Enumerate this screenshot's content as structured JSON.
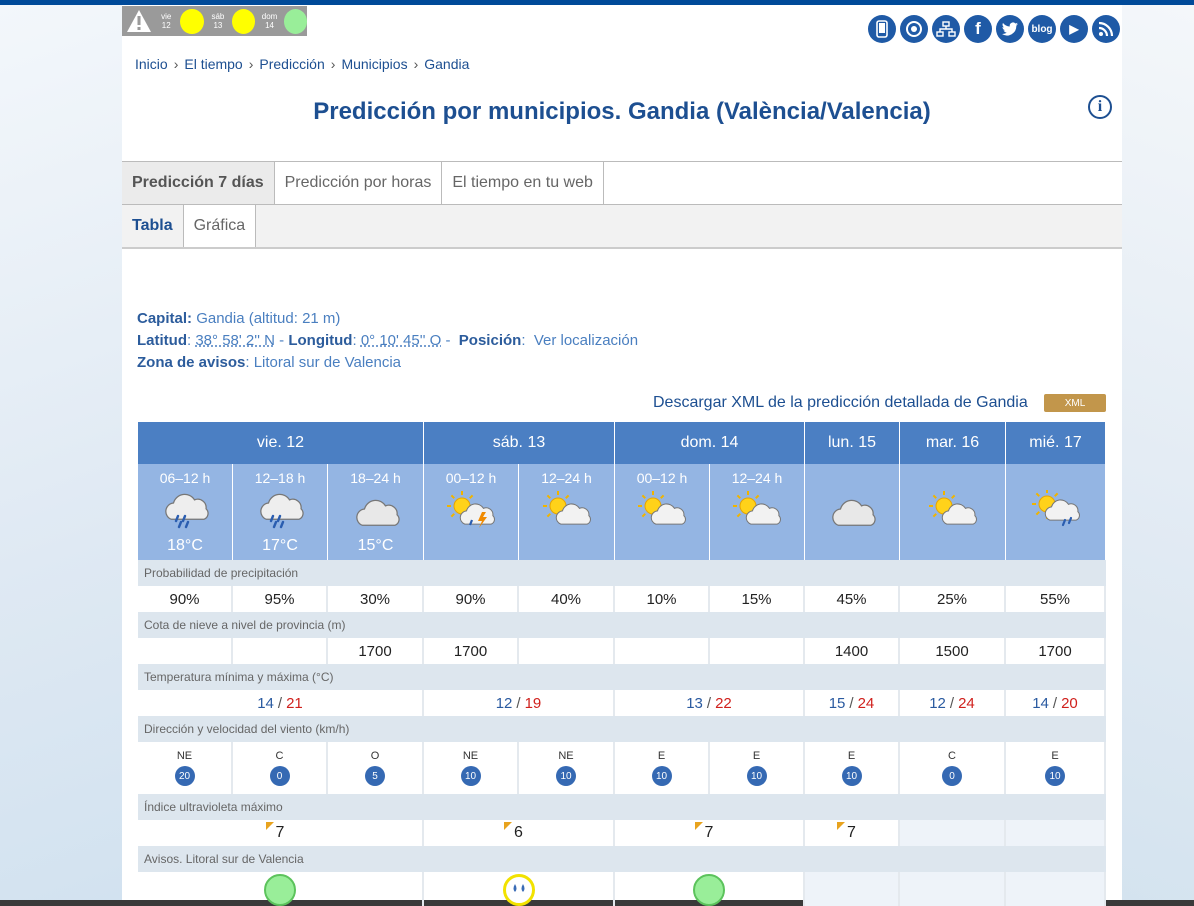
{
  "warnings_mini": {
    "days": [
      {
        "label": "vie\n12",
        "d": "vie",
        "n": "12",
        "color": "#ffff00"
      },
      {
        "label": "sáb\n13",
        "d": "sáb",
        "n": "13",
        "color": "#ffff00"
      },
      {
        "label": "dom\n14",
        "d": "dom",
        "n": "14",
        "color": "#99ee99"
      }
    ]
  },
  "social": [
    "mobile-icon",
    "hub-icon",
    "sitemap-icon",
    "facebook-icon",
    "twitter-icon",
    "blog-icon",
    "youtube-icon",
    "rss-icon"
  ],
  "social_labels": {
    "facebook": "f",
    "blog": "blog",
    "youtube": "▶",
    "rss": ")))"
  },
  "breadcrumb": [
    "Inicio",
    "El tiempo",
    "Predicción",
    "Municipios",
    "Gandia"
  ],
  "title": "Predicción por municipios. Gandia (València/Valencia)",
  "tabs_main": [
    "Predicción 7 días",
    "Predicción por horas",
    "El tiempo en tu web"
  ],
  "tabs_sub": [
    "Tabla",
    "Gráfica"
  ],
  "info": {
    "capital_label": "Capital:",
    "capital_value": "Gandia (altitud: 21 m)",
    "lat_label": "Latitud",
    "lat_value": "38° 58' 2'' N",
    "lon_label": "Longitud",
    "lon_value": "0° 10' 45'' O",
    "pos_label": "Posición",
    "pos_value": "Ver localización",
    "zone_label": "Zona de avisos",
    "zone_value": "Litoral sur de Valencia"
  },
  "xml": {
    "link": "Descargar XML de la predicción detallada de Gandia",
    "badge": "XML"
  },
  "days": [
    "vie. 12",
    "sáb. 13",
    "dom. 14",
    "lun. 15",
    "mar. 16",
    "mié. 17"
  ],
  "periods": [
    {
      "time": "06–12 h",
      "icon": "rain-cloud",
      "temp": "18°C"
    },
    {
      "time": "12–18 h",
      "icon": "rain-cloud",
      "temp": "17°C"
    },
    {
      "time": "18–24 h",
      "icon": "cloud",
      "temp": "15°C"
    },
    {
      "time": "00–12 h",
      "icon": "sun-storm",
      "temp": ""
    },
    {
      "time": "12–24 h",
      "icon": "sun-cloud",
      "temp": ""
    },
    {
      "time": "00–12 h",
      "icon": "sun-cloud",
      "temp": ""
    },
    {
      "time": "12–24 h",
      "icon": "sun-cloud",
      "temp": ""
    },
    {
      "time": "",
      "icon": "cloud",
      "temp": ""
    },
    {
      "time": "",
      "icon": "sun-cloud",
      "temp": ""
    },
    {
      "time": "",
      "icon": "sun-rain",
      "temp": ""
    }
  ],
  "labels": {
    "precip": "Probabilidad de precipitación",
    "snow": "Cota de nieve a nivel de provincia (m)",
    "temp": "Temperatura mínima y máxima (°C)",
    "wind": "Dirección y velocidad del viento (km/h)",
    "uv": "Índice ultravioleta máximo",
    "warn": "Avisos. Litoral sur de Valencia"
  },
  "precip": [
    "90%",
    "95%",
    "30%",
    "90%",
    "40%",
    "10%",
    "15%",
    "45%",
    "25%",
    "55%"
  ],
  "snow": [
    "",
    "",
    "1700",
    "1700",
    "",
    "",
    "",
    "1400",
    "1500",
    "1700"
  ],
  "temps": [
    {
      "min": "14",
      "max": "21"
    },
    {
      "min": "12",
      "max": "19"
    },
    {
      "min": "13",
      "max": "22"
    },
    {
      "min": "15",
      "max": "24"
    },
    {
      "min": "12",
      "max": "24"
    },
    {
      "min": "14",
      "max": "20"
    }
  ],
  "wind": [
    {
      "dir": "NE",
      "speed": "20"
    },
    {
      "dir": "C",
      "speed": "0"
    },
    {
      "dir": "O",
      "speed": "5"
    },
    {
      "dir": "NE",
      "speed": "10"
    },
    {
      "dir": "NE",
      "speed": "10"
    },
    {
      "dir": "E",
      "speed": "10"
    },
    {
      "dir": "E",
      "speed": "10"
    },
    {
      "dir": "E",
      "speed": "10"
    },
    {
      "dir": "C",
      "speed": "0"
    },
    {
      "dir": "E",
      "speed": "10"
    }
  ],
  "uv": [
    "7",
    "6",
    "7",
    "7",
    "",
    ""
  ],
  "warnings": [
    {
      "level": "green",
      "color": "#99ee99"
    },
    {
      "level": "yellow-rain",
      "color": "#ffff00"
    },
    {
      "level": "green",
      "color": "#99ee99"
    }
  ]
}
